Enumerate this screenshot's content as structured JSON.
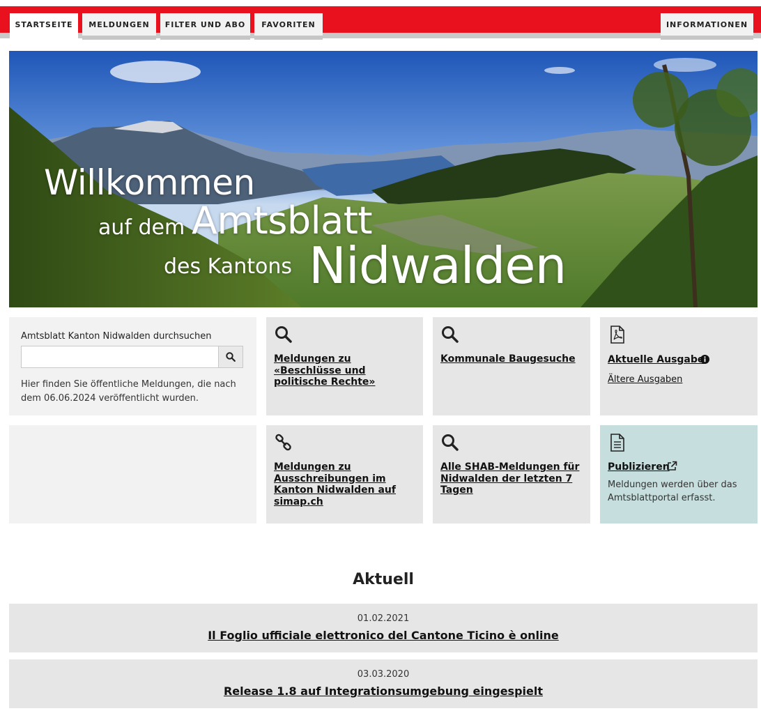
{
  "nav": {
    "tabs": [
      {
        "label": "STARTSEITE",
        "active": true
      },
      {
        "label": "MELDUNGEN",
        "active": false
      },
      {
        "label": "FILTER UND ABO",
        "active": false
      },
      {
        "label": "FAVORITEN",
        "active": false
      }
    ],
    "info_label": "INFORMATIONEN"
  },
  "hero": {
    "line1": "Willkommen",
    "line2_small": "auf dem",
    "line2_big": "Amtsblatt",
    "line3_small": "des Kantons",
    "line3_big": "Nidwalden"
  },
  "search": {
    "label": "Amtsblatt Kanton Nidwalden durchsuchen",
    "value": "",
    "placeholder": "",
    "description": "Hier finden Sie öffentliche Meldungen, die nach dem 06.06.2024 veröffentlicht wurden."
  },
  "tiles": {
    "beschluesse": {
      "icon": "search-icon",
      "title": "Meldungen zu «Beschlüsse und politische Rechte»"
    },
    "baugesuche": {
      "icon": "search-icon",
      "title": "Kommunale Baugesuche"
    },
    "ausgabe": {
      "icon": "pdf-icon",
      "title": "Aktuelle Ausgabe",
      "info_icon": "info-icon",
      "sub": "Ältere Ausgaben"
    },
    "simap": {
      "icon": "link-icon",
      "title": "Meldungen zu Ausschreibungen im Kanton Nidwalden auf simap.ch"
    },
    "shab": {
      "icon": "search-icon",
      "title": "Alle SHAB-Meldungen für Nidwalden der letzten 7 Tagen"
    },
    "publizieren": {
      "icon": "document-icon",
      "title": "Publizieren",
      "external_icon": "external-link-icon",
      "description": "Meldungen werden über das Amtsblattportal erfasst."
    }
  },
  "aktuell": {
    "title": "Aktuell",
    "items": [
      {
        "date": "01.02.2021",
        "title": "Il Foglio ufficiale elettronico del Cantone Ticino è online"
      },
      {
        "date": "03.03.2020",
        "title": "Release 1.8 auf Integrationsumgebung eingespielt"
      }
    ]
  },
  "colors": {
    "brand_red": "#e8111d",
    "tile_grey": "#e6e6e6",
    "tile_teal": "#c6dedd"
  }
}
